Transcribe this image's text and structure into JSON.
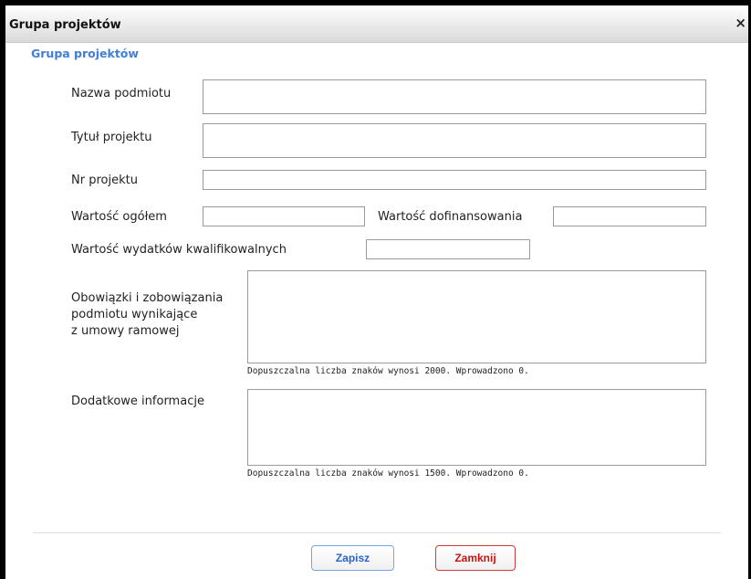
{
  "dialog": {
    "title": "Grupa projektów",
    "close_glyph": "×",
    "section_title": "Grupa projektów"
  },
  "form": {
    "nazwa_podmiotu": {
      "label": "Nazwa podmiotu",
      "value": ""
    },
    "tytul_projektu": {
      "label": "Tytuł projektu",
      "value": ""
    },
    "nr_projektu": {
      "label": "Nr projektu",
      "value": ""
    },
    "wartosc_ogolem": {
      "label": "Wartość ogółem",
      "value": ""
    },
    "wartosc_dofinansowania": {
      "label": "Wartość dofinansowania",
      "value": ""
    },
    "wartosc_wydatkow": {
      "label": "Wartość wydatków kwalifikowalnych",
      "value": ""
    },
    "obowiazki": {
      "label_lines": [
        "Obowiązki i zobowiązania",
        "podmiotu  wynikające",
        "z umowy ramowej"
      ],
      "value": "",
      "hint": "Dopuszczalna liczba znaków wynosi 2000. Wprowadzono 0."
    },
    "dodatkowe": {
      "label": "Dodatkowe informacje",
      "value": "",
      "hint": "Dopuszczalna liczba znaków wynosi 1500. Wprowadzono 0."
    }
  },
  "buttons": {
    "save": "Zapisz",
    "close": "Zamknij"
  },
  "colors": {
    "section_title": "#3f7fd9",
    "save_border": "#7aa6e0",
    "close_border": "#d23b3b"
  }
}
